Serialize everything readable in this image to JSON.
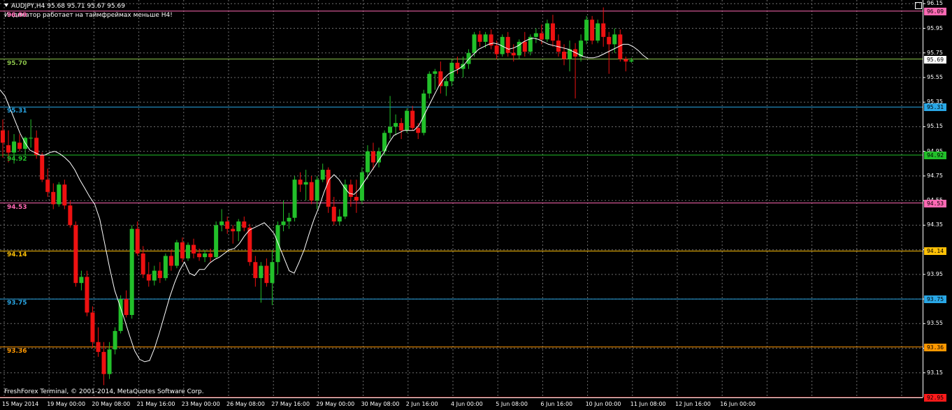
{
  "header": {
    "symbol_line": "AUDJPY,H4  95.68 95.71 95.67 95.69",
    "note": "Индикатор работает на таймфреймах меньше H4!"
  },
  "copyright": "FreshForex Terminal, © 2001-2014, MetaQuotes Software Corp.",
  "colors": {
    "background": "#000000",
    "grid": "#6e6e6e",
    "bull": "#22c02a",
    "bear": "#ee1111",
    "moving_average": "#ffffff"
  },
  "price_axis": {
    "min": 92.95,
    "max": 96.18,
    "ticks": [
      "96.15",
      "95.95",
      "95.75",
      "95.55",
      "95.35",
      "95.15",
      "94.95",
      "94.75",
      "94.55",
      "94.35",
      "94.15",
      "93.95",
      "93.75",
      "93.55",
      "93.35",
      "93.15"
    ]
  },
  "time_axis": {
    "labels": [
      "15 May 2014",
      "19 May 00:00",
      "20 May 08:00",
      "21 May 16:00",
      "23 May 00:00",
      "26 May 08:00",
      "27 May 16:00",
      "29 May 00:00",
      "30 May 08:00",
      "2 Jun 16:00",
      "4 Jun 00:00",
      "5 Jun 08:00",
      "6 Jun 16:00",
      "10 Jun 00:00",
      "11 Jun 08:00",
      "12 Jun 16:00",
      "16 Jun 00:00"
    ]
  },
  "levels": [
    {
      "label": "96.09",
      "tag": "96.09",
      "price": 96.09,
      "color": "#ff69b4",
      "tag_color": "#ff69b4"
    },
    {
      "label": "95.70",
      "tag": "95.69",
      "price": 95.7,
      "color": "#8bc34a",
      "tag_color": "#ffffff"
    },
    {
      "label": "95.31",
      "tag": "95.31",
      "price": 95.31,
      "color": "#29a7e6",
      "tag_color": "#29a7e6"
    },
    {
      "label": "94.92",
      "tag": "94.92",
      "price": 94.92,
      "color": "#22c02a",
      "tag_color": "#22c02a"
    },
    {
      "label": "94.53",
      "tag": "94.53",
      "price": 94.53,
      "color": "#ff69b4",
      "tag_color": "#ff69b4"
    },
    {
      "label": "94.14",
      "tag": "94.14",
      "price": 94.14,
      "color": "#ffc107",
      "tag_color": "#ffc107"
    },
    {
      "label": "93.75",
      "tag": "93.75",
      "price": 93.75,
      "color": "#29a7e6",
      "tag_color": "#29a7e6"
    },
    {
      "label": "93.36",
      "tag": "93.36",
      "price": 93.36,
      "color": "#ff9800",
      "tag_color": "#ff9800"
    },
    {
      "label": "",
      "tag": "92.95",
      "price": 92.95,
      "color": "#ff1a1a",
      "tag_color": "#ff1a1a"
    }
  ],
  "chart_data": {
    "type": "candlestick",
    "symbol": "AUDJPY",
    "timeframe": "H4",
    "candles": [
      [
        95.12,
        95.21,
        94.9,
        95.02
      ],
      [
        95.0,
        95.12,
        94.86,
        94.94
      ],
      [
        94.94,
        95.09,
        94.85,
        95.03
      ],
      [
        95.02,
        95.09,
        94.95,
        94.97
      ],
      [
        94.97,
        95.07,
        94.92,
        95.06
      ],
      [
        95.06,
        95.21,
        94.98,
        95.06
      ],
      [
        95.06,
        95.12,
        94.89,
        94.92
      ],
      [
        94.92,
        94.94,
        94.7,
        94.72
      ],
      [
        94.72,
        94.81,
        94.58,
        94.62
      ],
      [
        94.62,
        94.69,
        94.48,
        94.52
      ],
      [
        94.52,
        94.7,
        94.5,
        94.68
      ],
      [
        94.68,
        94.72,
        94.48,
        94.51
      ],
      [
        94.51,
        94.55,
        94.33,
        94.35
      ],
      [
        94.35,
        94.38,
        93.85,
        93.88
      ],
      [
        93.88,
        93.98,
        93.82,
        93.93
      ],
      [
        93.93,
        93.98,
        93.61,
        93.64
      ],
      [
        93.64,
        93.69,
        93.35,
        93.4
      ],
      [
        93.4,
        93.52,
        93.28,
        93.32
      ],
      [
        93.32,
        93.4,
        93.05,
        93.14
      ],
      [
        93.14,
        93.4,
        93.1,
        93.34
      ],
      [
        93.34,
        93.52,
        93.3,
        93.49
      ],
      [
        93.49,
        93.78,
        93.47,
        93.75
      ],
      [
        93.75,
        93.82,
        93.6,
        93.62
      ],
      [
        93.62,
        94.35,
        93.59,
        94.32
      ],
      [
        94.32,
        94.38,
        94.1,
        94.12
      ],
      [
        94.12,
        94.18,
        93.92,
        93.95
      ],
      [
        93.95,
        94.05,
        93.85,
        93.9
      ],
      [
        93.9,
        94.02,
        93.86,
        93.98
      ],
      [
        93.98,
        94.05,
        93.88,
        93.92
      ],
      [
        93.92,
        94.12,
        93.9,
        94.1
      ],
      [
        94.1,
        94.15,
        93.98,
        94.02
      ],
      [
        94.02,
        94.23,
        94.0,
        94.21
      ],
      [
        94.21,
        94.25,
        94.05,
        94.08
      ],
      [
        94.08,
        94.21,
        94.06,
        94.19
      ],
      [
        94.19,
        94.24,
        94.08,
        94.12
      ],
      [
        94.12,
        94.16,
        94.06,
        94.09
      ],
      [
        94.09,
        94.15,
        94.05,
        94.12
      ],
      [
        94.12,
        94.16,
        94.05,
        94.09
      ],
      [
        94.09,
        94.38,
        94.08,
        94.35
      ],
      [
        94.35,
        94.48,
        94.3,
        94.38
      ],
      [
        94.38,
        94.42,
        94.28,
        94.32
      ],
      [
        94.32,
        94.35,
        94.2,
        94.3
      ],
      [
        94.3,
        94.4,
        94.22,
        94.38
      ],
      [
        94.38,
        94.42,
        94.3,
        94.33
      ],
      [
        94.33,
        94.36,
        94.02,
        94.05
      ],
      [
        94.05,
        94.1,
        93.85,
        93.92
      ],
      [
        93.92,
        94.05,
        93.72,
        94.02
      ],
      [
        94.02,
        94.08,
        93.85,
        93.88
      ],
      [
        93.88,
        94.15,
        93.7,
        94.05
      ],
      [
        94.05,
        94.38,
        93.95,
        94.35
      ],
      [
        94.35,
        94.55,
        94.3,
        94.38
      ],
      [
        94.38,
        94.45,
        94.32,
        94.41
      ],
      [
        94.41,
        94.75,
        94.38,
        94.72
      ],
      [
        94.72,
        94.78,
        94.62,
        94.68
      ],
      [
        94.68,
        94.8,
        94.55,
        94.7
      ],
      [
        94.7,
        94.75,
        94.52,
        94.55
      ],
      [
        94.55,
        94.75,
        94.48,
        94.72
      ],
      [
        94.72,
        94.85,
        94.7,
        94.8
      ],
      [
        94.8,
        94.82,
        94.45,
        94.5
      ],
      [
        94.5,
        94.58,
        94.35,
        94.38
      ],
      [
        94.38,
        94.48,
        94.35,
        94.42
      ],
      [
        94.42,
        94.72,
        94.4,
        94.68
      ],
      [
        94.68,
        94.72,
        94.5,
        94.58
      ],
      [
        94.58,
        94.72,
        94.45,
        94.55
      ],
      [
        94.55,
        94.82,
        94.52,
        94.78
      ],
      [
        94.78,
        95.0,
        94.72,
        94.95
      ],
      [
        94.95,
        95.02,
        94.8,
        94.86
      ],
      [
        94.86,
        94.98,
        94.82,
        94.95
      ],
      [
        94.95,
        95.12,
        94.92,
        95.1
      ],
      [
        95.1,
        95.4,
        95.05,
        95.15
      ],
      [
        95.15,
        95.25,
        95.08,
        95.18
      ],
      [
        95.18,
        95.22,
        95.05,
        95.12
      ],
      [
        95.12,
        95.3,
        95.1,
        95.28
      ],
      [
        95.28,
        95.32,
        95.12,
        95.14
      ],
      [
        95.14,
        95.18,
        95.05,
        95.1
      ],
      [
        95.1,
        95.45,
        95.08,
        95.42
      ],
      [
        95.42,
        95.6,
        95.38,
        95.58
      ],
      [
        95.58,
        95.62,
        95.45,
        95.6
      ],
      [
        95.6,
        95.68,
        95.42,
        95.48
      ],
      [
        95.48,
        95.55,
        95.4,
        95.52
      ],
      [
        95.52,
        95.7,
        95.48,
        95.67
      ],
      [
        95.67,
        95.72,
        95.58,
        95.62
      ],
      [
        95.62,
        95.72,
        95.55,
        95.66
      ],
      [
        95.66,
        95.78,
        95.62,
        95.75
      ],
      [
        95.75,
        95.92,
        95.72,
        95.9
      ],
      [
        95.9,
        95.93,
        95.8,
        95.84
      ],
      [
        95.84,
        95.92,
        95.79,
        95.9
      ],
      [
        95.9,
        95.94,
        95.78,
        95.81
      ],
      [
        95.81,
        95.85,
        95.7,
        95.74
      ],
      [
        95.74,
        95.9,
        95.72,
        95.88
      ],
      [
        95.88,
        95.92,
        95.72,
        95.75
      ],
      [
        95.75,
        95.82,
        95.68,
        95.73
      ],
      [
        95.73,
        95.86,
        95.7,
        95.84
      ],
      [
        95.84,
        95.92,
        95.72,
        95.76
      ],
      [
        95.76,
        95.9,
        95.73,
        95.88
      ],
      [
        95.88,
        95.95,
        95.83,
        95.91
      ],
      [
        95.91,
        95.98,
        95.82,
        95.86
      ],
      [
        95.86,
        96.02,
        95.84,
        95.99
      ],
      [
        95.99,
        96.06,
        95.8,
        95.85
      ],
      [
        95.85,
        95.9,
        95.72,
        95.76
      ],
      [
        95.76,
        95.82,
        95.65,
        95.7
      ],
      [
        95.7,
        95.85,
        95.6,
        95.78
      ],
      [
        95.78,
        95.83,
        95.38,
        95.72
      ],
      [
        95.72,
        95.9,
        95.68,
        95.85
      ],
      [
        95.85,
        96.05,
        95.82,
        96.02
      ],
      [
        96.02,
        96.05,
        95.82,
        95.85
      ],
      [
        95.85,
        96.02,
        95.83,
        95.99
      ],
      [
        95.99,
        96.12,
        95.8,
        95.88
      ],
      [
        95.88,
        95.92,
        95.58,
        95.82
      ],
      [
        95.82,
        95.95,
        95.75,
        95.9
      ],
      [
        95.9,
        95.94,
        95.68,
        95.7
      ],
      [
        95.7,
        95.72,
        95.6,
        95.68
      ],
      [
        95.68,
        95.71,
        95.67,
        95.69
      ]
    ],
    "moving_average": [
      95.45,
      95.4,
      95.3,
      95.2,
      95.1,
      95.02,
      94.96,
      94.94,
      94.92,
      94.92,
      94.94,
      94.95,
      94.93,
      94.9,
      94.86,
      94.8,
      94.72,
      94.65,
      94.58,
      94.52,
      94.4,
      94.2,
      94.0,
      93.82,
      93.7,
      93.58,
      93.45,
      93.33,
      93.26,
      93.24,
      93.25,
      93.35,
      93.48,
      93.62,
      93.76,
      93.88,
      93.98,
      94.05,
      93.96,
      93.94,
      93.99,
      93.99,
      94.04,
      94.07,
      94.09,
      94.12,
      94.15,
      94.16,
      94.2,
      94.26,
      94.31,
      94.33,
      94.35,
      94.37,
      94.33,
      94.28,
      94.18,
      94.08,
      93.98,
      93.96,
      94.05,
      94.15,
      94.28,
      94.4,
      94.5,
      94.62,
      94.72,
      94.76,
      94.72,
      94.66,
      94.61,
      94.6,
      94.64,
      94.7,
      94.76,
      94.82,
      94.88,
      94.94,
      95.02,
      95.08,
      95.1,
      95.12,
      95.12,
      95.12,
      95.16,
      95.24,
      95.32,
      95.4,
      95.48,
      95.54,
      95.58,
      95.6,
      95.62,
      95.65,
      95.7,
      95.74,
      95.78,
      95.8,
      95.82,
      95.83,
      95.82,
      95.8,
      95.78,
      95.79,
      95.81,
      95.84,
      95.86,
      95.87,
      95.86,
      95.84,
      95.82,
      95.81,
      95.8,
      95.79,
      95.78,
      95.76,
      95.74,
      95.72,
      95.71,
      95.71,
      95.72,
      95.74,
      95.76,
      95.78,
      95.8,
      95.82,
      95.82,
      95.8,
      95.77,
      95.73,
      95.7
    ]
  }
}
